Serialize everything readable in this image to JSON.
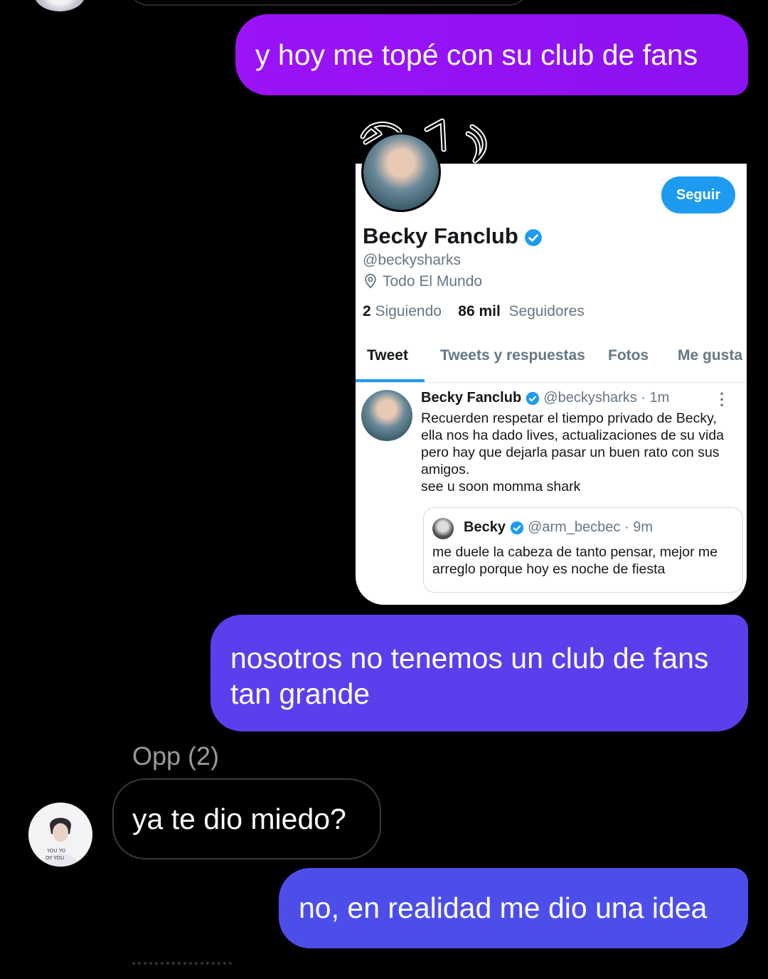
{
  "messages": {
    "out1": "y hoy me topé con su club de fans",
    "out2": "nosotros no tenemos un club de fans tan grande",
    "sender_name": "Opp (2)",
    "in1": "ya te dio miedo?",
    "out3": "no, en realidad me dio una idea"
  },
  "shared_profile": {
    "follow_label": "Seguir",
    "display_name": "Becky Fanclub",
    "handle": "@beckysharks",
    "location": "Todo El Mundo",
    "following_count": "2",
    "following_label": "Siguiendo",
    "followers_count": "86 mil",
    "followers_label": "Seguidores",
    "tabs": [
      "Tweet",
      "Tweets y respuestas",
      "Fotos",
      "Me gusta"
    ],
    "tweet": {
      "name": "Becky Fanclub",
      "handle_time": "@beckysharks · 1m",
      "body": "Recuerden respetar el tiempo privado de Becky, ella nos ha dado lives, actualizaciones de su vida pero hay que dejarla pasar un buen rato con sus amigos.",
      "body2": "see u soon momma shark",
      "more_icon": "⋮"
    },
    "quote": {
      "name": "Becky",
      "handle_time": "@arm_becbec · 9m",
      "body": "me duele la cabeza de tanto pensar, mejor me arreglo porque hoy es noche de fiesta"
    }
  },
  "colors": {
    "bubble1": "#9b13f7",
    "bubble2": "#5b3fed",
    "bubble3": "#4d4eea",
    "twitter_blue": "#1d9bf0"
  }
}
